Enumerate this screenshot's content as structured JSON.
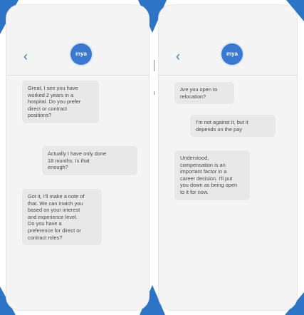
{
  "screens": [
    {
      "back_icon": "chevron-left-icon",
      "logo_text": "mya",
      "messages": [
        {
          "sender": "bot",
          "text": "Great, I see you have\nworked 2 years in a\nhospital. Do you prefer\ndirect or contract\npositions?"
        },
        {
          "sender": "user",
          "text": "Actually I have only done\n18 months. Is that\nenough?"
        },
        {
          "sender": "bot",
          "text": "Got it, I'll make a note of\nthat. We can match you\nbased on your interest\nand experience level.\nDo you have a\npreference for direct or\ncontract roles?"
        }
      ]
    },
    {
      "back_icon": "chevron-left-icon",
      "logo_text": "mya",
      "messages": [
        {
          "sender": "bot",
          "text": "Are you open to\nrelocation?"
        },
        {
          "sender": "user",
          "text": "I'm not against it, but it\ndepends on the pay"
        },
        {
          "sender": "bot",
          "text": "Understood,\ncompensation is an\nimportant factor in a\ncareer decision. I'll put\nyou down as being open\nto it for now."
        }
      ]
    }
  ],
  "colors": {
    "accent": "#2d73c6",
    "logo": "#3b79d0",
    "bubble": "#e8e8e8",
    "screen_bg": "#f4f4f4"
  }
}
